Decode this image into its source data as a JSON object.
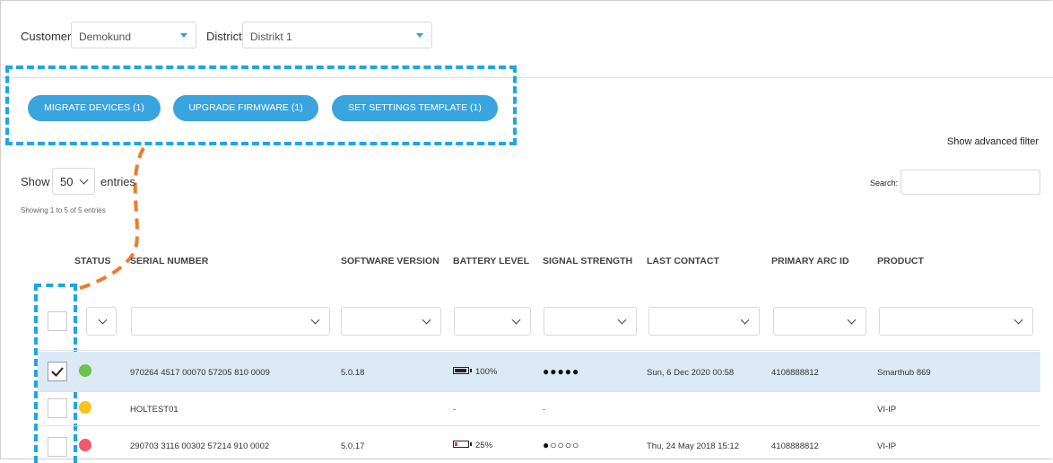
{
  "filters": {
    "customer_label": "Customer",
    "customer_value": "Demokund",
    "district_label": "District",
    "district_value": "Distrikt 1"
  },
  "actions": {
    "migrate_label": "MIGRATE DEVICES (1)",
    "upgrade_label": "UPGRADE FIRMWARE (1)",
    "template_label": "SET SETTINGS TEMPLATE (1)"
  },
  "advanced_filter_label": "Show advanced filter",
  "table_controls": {
    "show_label": "Show",
    "entries_value": "50",
    "entries_label": "entries",
    "info": "Showing 1 to 5 of 5 entries",
    "search_label": "Search:",
    "search_value": ""
  },
  "columns": [
    "STATUS",
    "SERIAL NUMBER",
    "SOFTWARE VERSION",
    "BATTERY LEVEL",
    "SIGNAL STRENGTH",
    "LAST CONTACT",
    "PRIMARY ARC ID",
    "PRODUCT"
  ],
  "rows": [
    {
      "selected": true,
      "status_color": "#6cc24a",
      "serial": "970264 4517 00070 57205 810 0009",
      "software": "5.0.18",
      "battery": "100%",
      "battery_level": 1.0,
      "signal": "●●●●●",
      "last_contact": "Sun, 6 Dec 2020 00:58",
      "arc_id": "4108888812",
      "product": "Smarthub 869"
    },
    {
      "selected": false,
      "status_color": "#f5c518",
      "serial": "HOLTEST01",
      "software": "",
      "battery": "-",
      "battery_level": null,
      "signal": "-",
      "last_contact": "",
      "arc_id": "",
      "product": "VI-IP"
    },
    {
      "selected": false,
      "status_color": "#ef5a6f",
      "serial": "290703 3116 00302 57214 910 0002",
      "software": "5.0.17",
      "battery": "25%",
      "battery_level": 0.25,
      "signal": "●○○○○",
      "last_contact": "Thu, 24 May 2018 15:12",
      "arc_id": "4108888812",
      "product": "VI-IP"
    }
  ],
  "colors": {
    "accent": "#3aa4de",
    "highlight_dash": "#1ea7e3",
    "connector": "#f07a2c",
    "selected_row": "#dce9f7"
  }
}
